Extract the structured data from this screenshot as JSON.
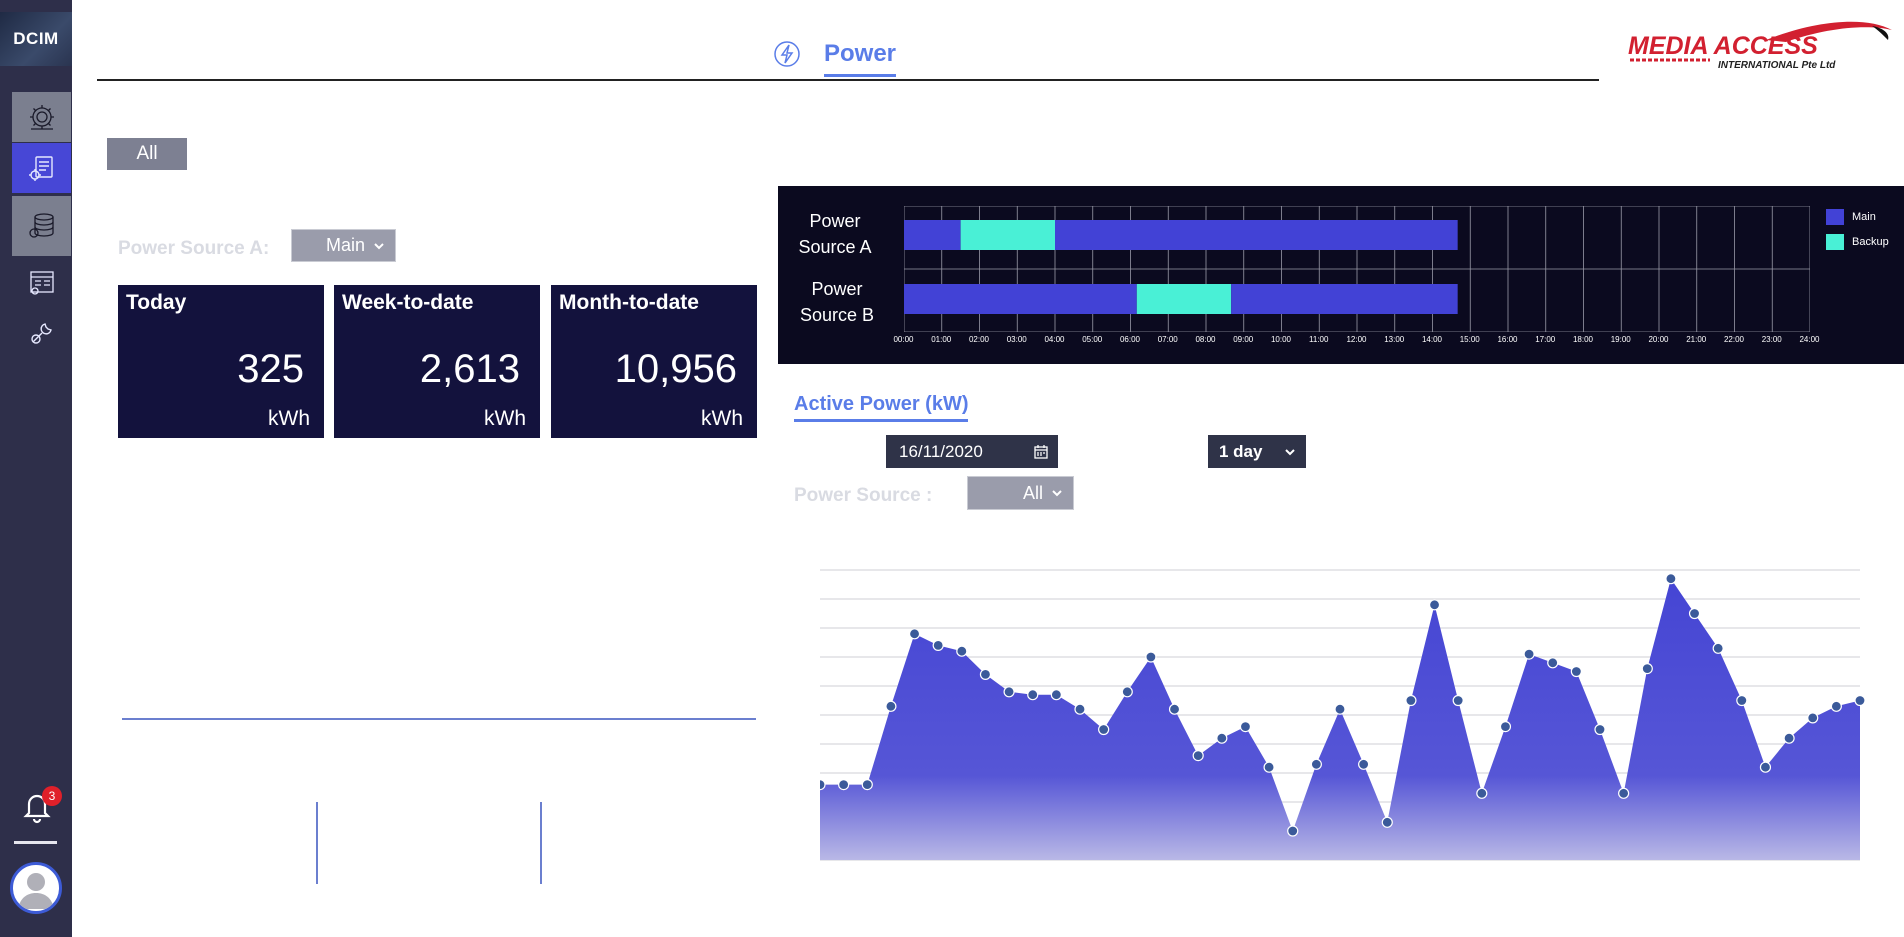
{
  "sidebar": {
    "logo": "DCIM",
    "items": [
      {
        "icon": "gear-settings-icon"
      },
      {
        "icon": "report-icon"
      },
      {
        "icon": "database-icon"
      },
      {
        "icon": "dashboard-icon"
      },
      {
        "icon": "tools-icon"
      }
    ],
    "notifications": {
      "icon": "bell-icon",
      "count": "3"
    },
    "avatar": {
      "icon": "user-icon"
    }
  },
  "header": {
    "title": "Power",
    "title_icon": "lightning-icon",
    "brand": {
      "line1": "MEDIA ACCESS",
      "line2": "INTERNATIONAL Pte Ltd"
    }
  },
  "filter": {
    "all_label": "All"
  },
  "source_selector": {
    "label": "Power Source A:",
    "value": "Main"
  },
  "energy_cards": [
    {
      "title": "Today",
      "value": "325",
      "unit": "kWh"
    },
    {
      "title": "Week-to-date",
      "value": "2,613",
      "unit": "kWh"
    },
    {
      "title": "Month-to-date",
      "value": "10,956",
      "unit": "kWh"
    }
  ],
  "source_timeline": {
    "rows": [
      {
        "label_line1": "Power",
        "label_line2": "Source A"
      },
      {
        "label_line1": "Power",
        "label_line2": "Source B"
      }
    ],
    "ticks": [
      "00:00",
      "01:00",
      "02:00",
      "03:00",
      "04:00",
      "05:00",
      "06:00",
      "07:00",
      "08:00",
      "09:00",
      "10:00",
      "11:00",
      "12:00",
      "13:00",
      "14:00",
      "15:00",
      "16:00",
      "17:00",
      "18:00",
      "19:00",
      "20:00",
      "21:00",
      "22:00",
      "23:00",
      "24:00"
    ],
    "legend": [
      {
        "name": "Main",
        "color": "#4242d6"
      },
      {
        "name": "Backup",
        "color": "#49f0d6"
      }
    ]
  },
  "active_power": {
    "title": "Active Power (kW)",
    "date": "16/11/2020",
    "range": "1 day",
    "source_label": "Power Source :",
    "source_value": "All"
  },
  "chart_data": [
    {
      "type": "bar",
      "title": "",
      "x_range": [
        "00:00",
        "24:00"
      ],
      "series": [
        {
          "name": "Power Source A",
          "segments": [
            {
              "state": "Main",
              "start": "00:00",
              "end": "01:30"
            },
            {
              "state": "Backup",
              "start": "01:30",
              "end": "04:00"
            },
            {
              "state": "Main",
              "start": "04:00",
              "end": "14:40"
            }
          ]
        },
        {
          "name": "Power Source B",
          "segments": [
            {
              "state": "Main",
              "start": "00:00",
              "end": "06:10"
            },
            {
              "state": "Backup",
              "start": "06:10",
              "end": "08:40"
            },
            {
              "state": "Main",
              "start": "08:40",
              "end": "14:40"
            }
          ]
        }
      ],
      "grid": true,
      "legend": "right"
    },
    {
      "type": "area",
      "title": "",
      "xlabel": "",
      "ylabel": "",
      "ylim": [
        0,
        10
      ],
      "grid": true,
      "series": [
        {
          "values": [
            2.6,
            2.6,
            2.6,
            5.3,
            7.8,
            7.4,
            7.2,
            6.4,
            5.8,
            5.7,
            5.7,
            5.2,
            4.5,
            5.8,
            7.0,
            5.2,
            3.6,
            4.2,
            4.6,
            3.2,
            1.0,
            3.3,
            5.2,
            3.3,
            1.3,
            5.5,
            8.8,
            5.5,
            2.3,
            4.6,
            7.1,
            6.8,
            6.5,
            4.5,
            2.3,
            6.6,
            9.7,
            8.5,
            7.3,
            5.5,
            3.2,
            4.2,
            4.9,
            5.3,
            5.5
          ]
        }
      ]
    }
  ]
}
